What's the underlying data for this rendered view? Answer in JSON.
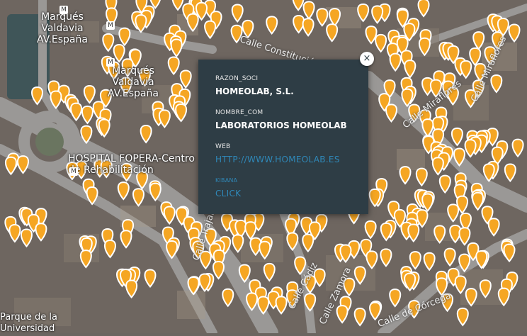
{
  "map": {
    "places": [
      {
        "id": "marques-valdavia-1",
        "lines": [
          "Marqués",
          "Valdavia",
          "AV.España"
        ]
      },
      {
        "id": "marques-valdavia-2",
        "lines": [
          "Marqués",
          "Valdavia",
          "AV.España"
        ]
      },
      {
        "id": "hospital",
        "lines": [
          "HOSPITAL FOPERA-Centro",
          "de Rehabilitación"
        ]
      },
      {
        "id": "parque",
        "lines": [
          "Parque de la",
          "Universidad"
        ]
      }
    ],
    "streets": [
      "Calle Constitución",
      "Calle Miraflores",
      "Calle Miraflores",
      "Calle Trajano",
      "Calle Cádiz",
      "Calle Zamora",
      "Calle de Córcega"
    ],
    "metro_icon": "metro-station-icon",
    "marker_icon": "map-pin-icon",
    "marker_color": "#f5a623"
  },
  "popup": {
    "fields": [
      {
        "label": "RAZON_SOCI",
        "value": "HOMEOLAB, S.L."
      },
      {
        "label": "NOMBRE_COM",
        "value": "LABORATORIOS HOMEOLAB"
      },
      {
        "label": "WEB",
        "value": "HTTP://WWW.HOMEOLAB.ES"
      },
      {
        "label": "KIBANA",
        "value": "CLICK"
      }
    ],
    "close_icon": "close-icon",
    "close_glyph": "×",
    "background": "#2e3d45",
    "link_color": "#2f88b8"
  }
}
